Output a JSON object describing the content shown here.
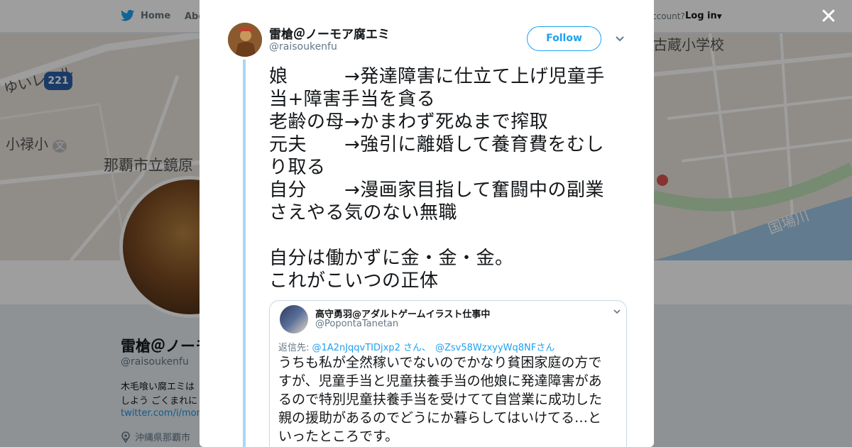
{
  "nav": {
    "home": "Home",
    "about": "Abo",
    "account_prompt": "ccount?",
    "login": "Log in"
  },
  "map": {
    "label_rail": "ゆいレール",
    "label_route": "221",
    "label_school1": "小禄小",
    "label_school1_sym": "文",
    "label_school2": "那覇市立鏡原",
    "label_school3": "古蔵小学校",
    "label_river": "国場川"
  },
  "profile": {
    "name": "雷槍＠ノーモ",
    "handle": "@raisoukenfu",
    "bio_line1": "木毛喰い腐エミは",
    "bio_line2": "しよう ごくまれに",
    "link": "twitter.com/i/mom",
    "location": "沖縄県那覇市"
  },
  "tweet": {
    "author_name": "雷槍＠ノーモア腐エミ",
    "author_handle": "@raisoukenfu",
    "follow_label": "Follow",
    "lines": [
      "娘　　　→発達障害に仕立て上げ児童手",
      "当+障害手当を貪る",
      "老齢の母→かまわず死ぬまで搾取",
      "元夫　　→強引に離婚して養育費をむし",
      "り取る",
      "自分　　→漫画家目指して奮闘中の副業",
      "さえやる気のない無職",
      "",
      "自分は働かずに金・金・金。",
      "これがこいつの正体"
    ]
  },
  "quote": {
    "author_name": "高守勇羽@アダルトゲームイラスト仕事中",
    "author_handle": "@PopontaTanetan",
    "reply_prefix": "返信先: ",
    "mention1": "@1A2nJqqvTIDjxp2",
    "mention1_suffix": " さん、",
    "mention2": "@Zsv58WzxyyWq8NF",
    "mention2_suffix": "さん",
    "lines": [
      "うちも私が全然稼いでないのでかなり貧困家庭の方で",
      "すが、児童手当と児童扶養手当の他娘に発達障害があ",
      "るので特別児童扶養手当を受けてて自営業に成功した",
      "親の援助があるのでどうにか暮らしてはいけてる…と",
      "いったところです。"
    ]
  },
  "colors": {
    "accent": "#1da1f2",
    "thread_line": "#a8d7f2",
    "overlay": "rgba(0,0,0,0.38)"
  }
}
